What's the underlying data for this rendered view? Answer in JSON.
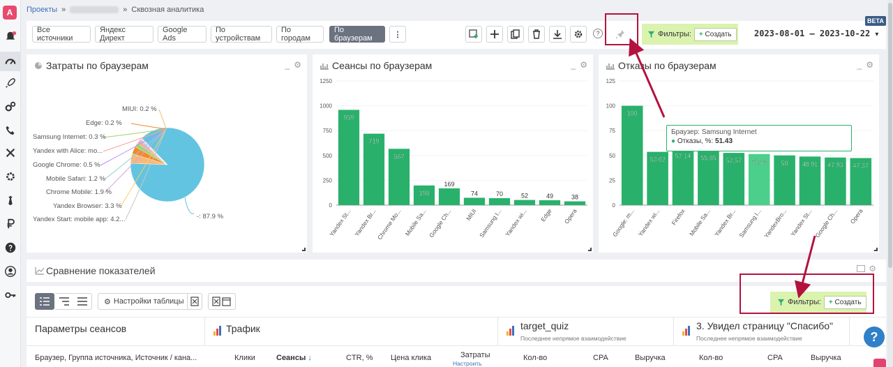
{
  "breadcrumb": {
    "projects": "Проекты",
    "sep": "»",
    "current": "Сквозная аналитика"
  },
  "logo": "A",
  "tabs": [
    "Все источники",
    "Яндекс Директ",
    "Google Ads",
    "По устройствам",
    "По городам",
    "По браузерам"
  ],
  "active_tab": "По браузерам",
  "toolbar": {
    "more": "⋮",
    "help": "?"
  },
  "filters": {
    "label": "Фильтры:",
    "create": "Создать"
  },
  "date_range": "2023-08-01 — 2023-10-22",
  "beta": "BETA",
  "panels": {
    "costs": {
      "title": "Затраты по браузерам"
    },
    "sessions": {
      "title": "Сеансы по браузерам"
    },
    "bounces": {
      "title": "Отказы по браузерам"
    }
  },
  "panel_ctrl": {
    "minimize": "_",
    "settings": "⚙"
  },
  "pie_labels": [
    "MIUI: 0.2 %",
    "Edge: 0.2 %",
    "Samsung Internet: 0.3 %",
    "Yandex with Alice: mo...",
    "Google Chrome: 0.5 %",
    "Mobile Safari: 1.2 %",
    "Chrome Mobile: 1.9 %",
    "Yandex Browser: 3.3 %",
    "Yandex Start: mobile app: 4.2...",
    "-: 87.9 %"
  ],
  "chart_data": [
    {
      "type": "pie",
      "title": "Затраты по браузерам",
      "slices": [
        {
          "label": "-",
          "value": 87.9
        },
        {
          "label": "Yandex Start: mobile app",
          "value": 4.2
        },
        {
          "label": "Yandex Browser",
          "value": 3.3
        },
        {
          "label": "Chrome Mobile",
          "value": 1.9
        },
        {
          "label": "Mobile Safari",
          "value": 1.2
        },
        {
          "label": "Google Chrome",
          "value": 0.5
        },
        {
          "label": "Yandex with Alice: mo...",
          "value": 0.4
        },
        {
          "label": "Samsung Internet",
          "value": 0.3
        },
        {
          "label": "Edge",
          "value": 0.2
        },
        {
          "label": "MIUI",
          "value": 0.2
        }
      ]
    },
    {
      "type": "bar",
      "title": "Сеансы по браузерам",
      "categories": [
        "Yandex St...",
        "Yandex Br...",
        "Chrome Mo...",
        "Mobile Sa...",
        "Google Ch...",
        "MIUI",
        "Samsung I...",
        "Yandex wi...",
        "Edge",
        "Opera"
      ],
      "values": [
        959,
        719,
        567,
        198,
        169,
        74,
        70,
        52,
        49,
        38
      ],
      "yticks": [
        0,
        250,
        500,
        750,
        1000,
        1250
      ],
      "ylim": [
        0,
        1250
      ],
      "color": "#29b16c"
    },
    {
      "type": "bar",
      "title": "Отказы по браузерам",
      "categories": [
        "Google: m...",
        "Yandex wi...",
        "Firefox",
        "Mobile Sa...",
        "Yandex Br...",
        "Samsung I...",
        "YandexBro...",
        "Yandex St...",
        "Google Ch...",
        "Opera"
      ],
      "values": [
        100,
        53.62,
        57.14,
        55.05,
        52.57,
        51.43,
        50,
        48.91,
        47.93,
        47.37
      ],
      "yticks": [
        0,
        25,
        50,
        75,
        100,
        125
      ],
      "ylim": [
        0,
        125
      ],
      "color": "#29b16c",
      "highlight_index": 5,
      "tooltip": {
        "title": "Браузер: Samsung Internet",
        "metric": "Отказы, %:",
        "value": "51.43"
      }
    }
  ],
  "comparison": {
    "title": "Сравнение показателей"
  },
  "table_toolbar": {
    "settings": "Настройки таблицы"
  },
  "table": {
    "params_header": "Параметры сеансов",
    "traffic_header": "Трафик",
    "goal1": {
      "title": "target_quiz",
      "sub": "Последнее непрямое взаимодействие"
    },
    "goal2": {
      "title": "3. Увидел страницу \"Спасибо\"",
      "sub": "Последнее непрямое взаимодействие"
    },
    "row_label": "Браузер, Группа источника, Источник / кана...",
    "cols": [
      "Клики",
      "Сеансы",
      "CTR, %",
      "Цена клика",
      "Затраты",
      "Кол-во",
      "CPA",
      "Выручка",
      "Кол-во",
      "CPA",
      "Выручка"
    ],
    "sort_arrow": "↓",
    "costs_setting": "Настроить"
  },
  "help": "?"
}
